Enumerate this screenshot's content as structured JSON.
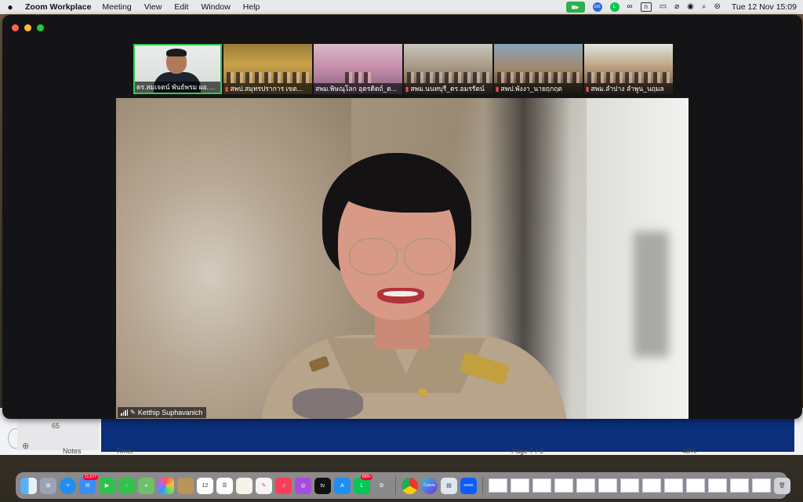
{
  "menubar": {
    "app_name": "Zoom Workplace",
    "menus": [
      "Meeting",
      "View",
      "Edit",
      "Window",
      "Help"
    ],
    "status_icons": [
      "zoom-camera-icon",
      "zoom-app-icon",
      "line-app-icon",
      "creative-cloud-icon",
      "input-source-icon",
      "battery-icon",
      "wifi-off-icon",
      "user-icon",
      "search-icon",
      "control-center-icon"
    ],
    "input_source": "ก",
    "datetime": "Tue 12 Nov  15:09"
  },
  "gallery": [
    {
      "label": "ดร.สมเจตน์ พันธ์พรม ผอ.ศู..."
    },
    {
      "label": "สพป.สมุทรปราการ เขต..."
    },
    {
      "label": "สพม.พิษณุโลก อุตรดิตถ์_ด..."
    },
    {
      "label": "สพม.นนทบุรี_ดร.อมรรัตน์"
    },
    {
      "label": "สพป.พังงา_นายฤกฤต"
    },
    {
      "label": "สพม.ลำปาง ลำพูน_นฤมล"
    }
  ],
  "main_video": {
    "speaker_name": "Ketthip Suphavanich"
  },
  "background_app": {
    "slide_number": "65",
    "notes": "Notes",
    "timer": "Timer",
    "page": "Page 7 / 9",
    "zoom": "45%"
  },
  "dock": {
    "calendar_date": "12",
    "mail_badge": "11,677",
    "line_badge": "999+",
    "apps": [
      "finder",
      "launchpad",
      "safari",
      "mail",
      "facetime",
      "messages",
      "maps",
      "photos",
      "notes",
      "calendar",
      "reminders",
      "freeform",
      "music",
      "podcasts",
      "apple-tv",
      "app-store",
      "line",
      "settings",
      "chrome",
      "canva",
      "preview",
      "zoom"
    ]
  },
  "colors": {
    "active_speaker": "#2ecc4f",
    "zoom_bg": "#141416",
    "muted": "#ff4d4d"
  }
}
